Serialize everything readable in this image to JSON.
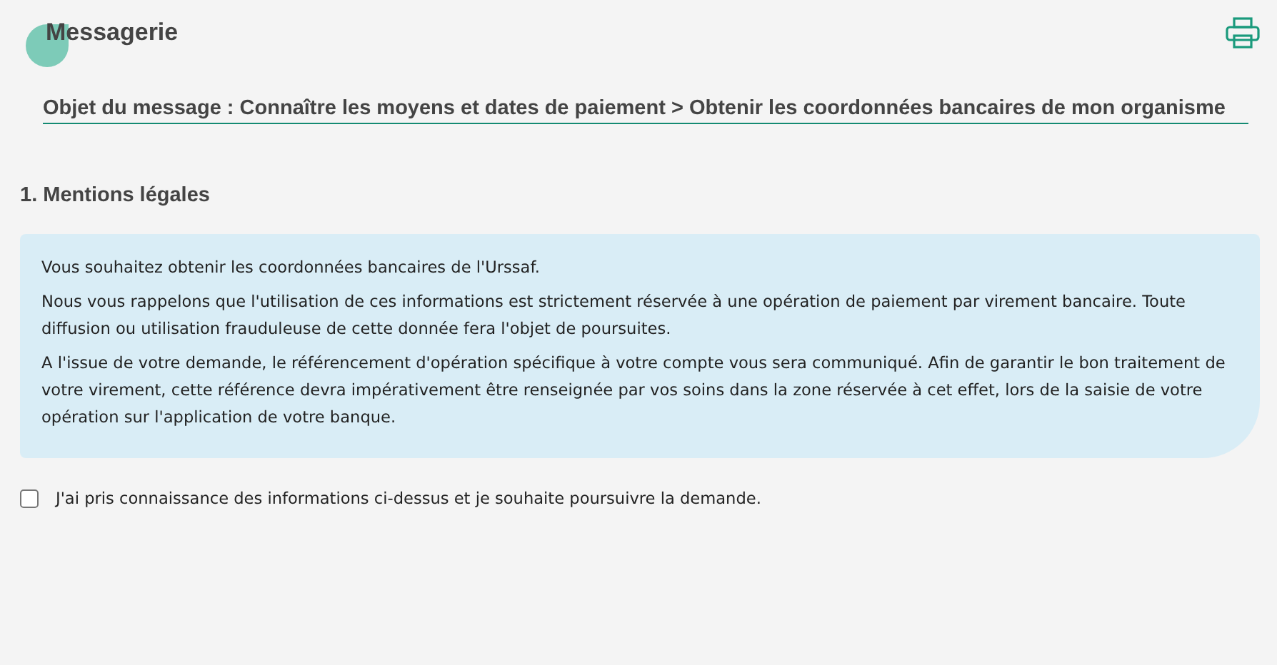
{
  "title": "Messagerie",
  "subject": "Objet du message : Connaître les moyens et dates de paiement > Obtenir les coordonnées bancaires de mon organisme",
  "section_title": "1. Mentions légales",
  "notice": [
    "Vous souhaitez obtenir les coordonnées bancaires de l'Urssaf.",
    "Nous vous rappelons que l'utilisation de ces informations est strictement réservée à une opération de paiement par virement bancaire. Toute diffusion ou utilisation frauduleuse de cette donnée fera l'objet de poursuites.",
    "A l'issue de votre demande, le référencement d'opération spécifique à votre compte vous sera communiqué. Afin de garantir le bon traitement de votre virement, cette référence devra impérativement être renseignée par vos soins dans la zone réservée à cet effet, lors de la saisie de votre opération sur l'application de votre banque."
  ],
  "consent": {
    "label": "J'ai pris connaissance des informations ci-dessus et je souhaite poursuivre la demande.",
    "checked": false
  }
}
